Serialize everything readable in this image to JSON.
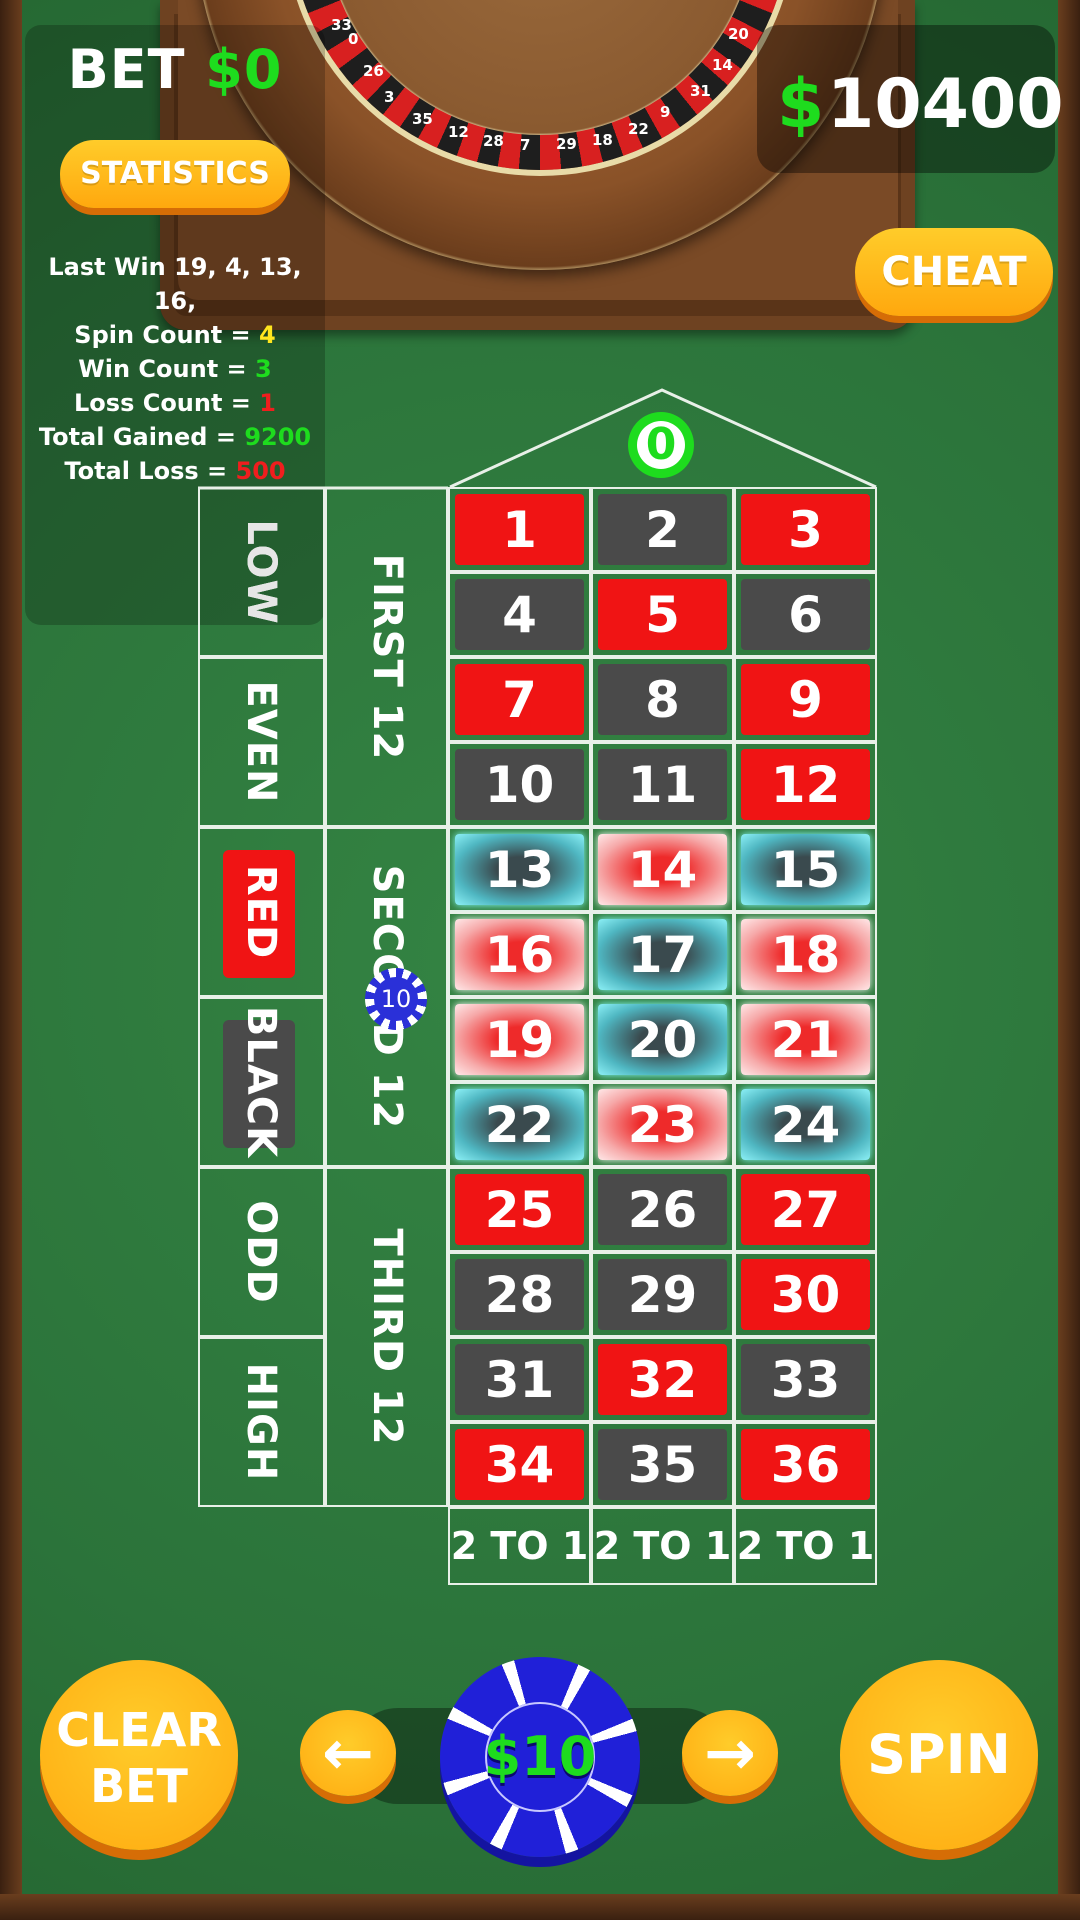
{
  "header": {
    "bet_label": "BET",
    "bet_currency": "$",
    "bet_amount": "0",
    "balance_currency": "$",
    "balance_amount": "10400"
  },
  "buttons": {
    "statistics": "STATISTICS",
    "cheat": "CHEAT",
    "clear_line1": "CLEAR",
    "clear_line2": "BET",
    "spin": "SPIN",
    "prev_chip": "←",
    "next_chip": "→"
  },
  "stats": {
    "last_win_label": "Last Win",
    "last_win_values": "19, 4, 13, 16,",
    "spin_count_label": "Spin Count =",
    "spin_count": "4",
    "win_count_label": "Win Count =",
    "win_count": "3",
    "loss_count_label": "Loss Count =",
    "loss_count": "1",
    "total_gained_label": "Total Gained =",
    "total_gained": "9200",
    "total_loss_label": "Total Loss =",
    "total_loss": "500"
  },
  "wheel_numbers": [
    "33",
    "0",
    "26",
    "3",
    "35",
    "12",
    "28",
    "7",
    "29",
    "18",
    "22",
    "9",
    "31",
    "14",
    "20"
  ],
  "board": {
    "zero": "0",
    "numbers": [
      [
        "1",
        "2",
        "3"
      ],
      [
        "4",
        "5",
        "6"
      ],
      [
        "7",
        "8",
        "9"
      ],
      [
        "10",
        "11",
        "12"
      ],
      [
        "13",
        "14",
        "15"
      ],
      [
        "16",
        "17",
        "18"
      ],
      [
        "19",
        "20",
        "21"
      ],
      [
        "22",
        "23",
        "24"
      ],
      [
        "25",
        "26",
        "27"
      ],
      [
        "28",
        "29",
        "30"
      ],
      [
        "31",
        "32",
        "33"
      ],
      [
        "34",
        "35",
        "36"
      ]
    ],
    "colors": [
      [
        "red",
        "black",
        "red"
      ],
      [
        "black",
        "red",
        "black"
      ],
      [
        "red",
        "black",
        "red"
      ],
      [
        "black",
        "black",
        "red"
      ],
      [
        "black",
        "red",
        "black"
      ],
      [
        "red",
        "black",
        "red"
      ],
      [
        "red",
        "black",
        "red"
      ],
      [
        "black",
        "red",
        "black"
      ],
      [
        "red",
        "black",
        "red"
      ],
      [
        "black",
        "black",
        "red"
      ],
      [
        "black",
        "red",
        "black"
      ],
      [
        "red",
        "black",
        "red"
      ]
    ],
    "highlighted_rows": [
      4,
      5,
      6,
      7
    ],
    "dozens": [
      "FIRST 12",
      "SECOND 12",
      "THIRD 12"
    ],
    "outside": [
      "LOW",
      "EVEN",
      "RED",
      "BLACK",
      "ODD",
      "HIGH"
    ],
    "columns": [
      "2 TO 1",
      "2 TO 1",
      "2 TO 1"
    ],
    "placed_chip": "10"
  },
  "chip_selector": {
    "current": "$10"
  },
  "colors": {
    "felt": "#2f7a3d",
    "red": "#f01414",
    "black": "#4a4a4a",
    "accent_green": "#1edc1e",
    "button_orange": "#ffb21a",
    "chip_blue": "#2020d8"
  }
}
